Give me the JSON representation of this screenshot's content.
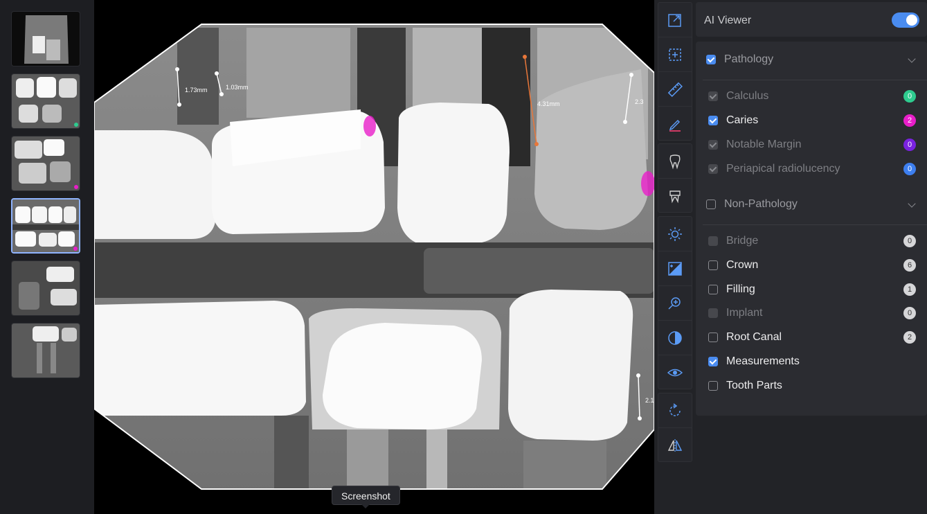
{
  "measurements": [
    {
      "label": "1.73mm"
    },
    {
      "label": "1.03mm"
    },
    {
      "label": "4.31mm"
    },
    {
      "label": "2.3"
    },
    {
      "label": "2.1"
    }
  ],
  "tooltip": "Screenshot",
  "toolbar": {
    "tools": [
      "expand-icon",
      "crop-icon",
      "ruler-icon",
      "pencil-icon",
      "tooth-icon",
      "crown-icon",
      "brightness-icon",
      "levels-icon",
      "zoom-in-icon",
      "contrast-icon",
      "eye-icon",
      "rotate-icon",
      "flip-icon"
    ]
  },
  "ai_viewer": {
    "title": "AI Viewer",
    "enabled": true
  },
  "pathology": {
    "title": "Pathology",
    "items": [
      {
        "label": "Calculus",
        "count": "0",
        "color": "#2ecc8f",
        "state": "disabled-check"
      },
      {
        "label": "Caries",
        "count": "2",
        "color": "#e91ec9",
        "state": "checked"
      },
      {
        "label": "Notable Margin",
        "count": "0",
        "color": "#7a22e0",
        "state": "disabled-check"
      },
      {
        "label": "Periapical radiolucency",
        "count": "0",
        "color": "#3d7ff0",
        "state": "disabled-check"
      }
    ]
  },
  "non_pathology": {
    "title": "Non-Pathology",
    "items": [
      {
        "label": "Bridge",
        "count": "0",
        "state": "disabled"
      },
      {
        "label": "Crown",
        "count": "6",
        "state": "unchecked"
      },
      {
        "label": "Filling",
        "count": "1",
        "state": "unchecked"
      },
      {
        "label": "Implant",
        "count": "0",
        "state": "disabled"
      },
      {
        "label": "Root Canal",
        "count": "2",
        "state": "unchecked"
      },
      {
        "label": "Measurements",
        "count": "",
        "state": "checked"
      },
      {
        "label": "Tooth Parts",
        "count": "",
        "state": "unchecked"
      }
    ]
  },
  "colors": {
    "accent": "#4a8cf0",
    "caries": "#e91ec9",
    "measure_active": "#e8773a"
  }
}
